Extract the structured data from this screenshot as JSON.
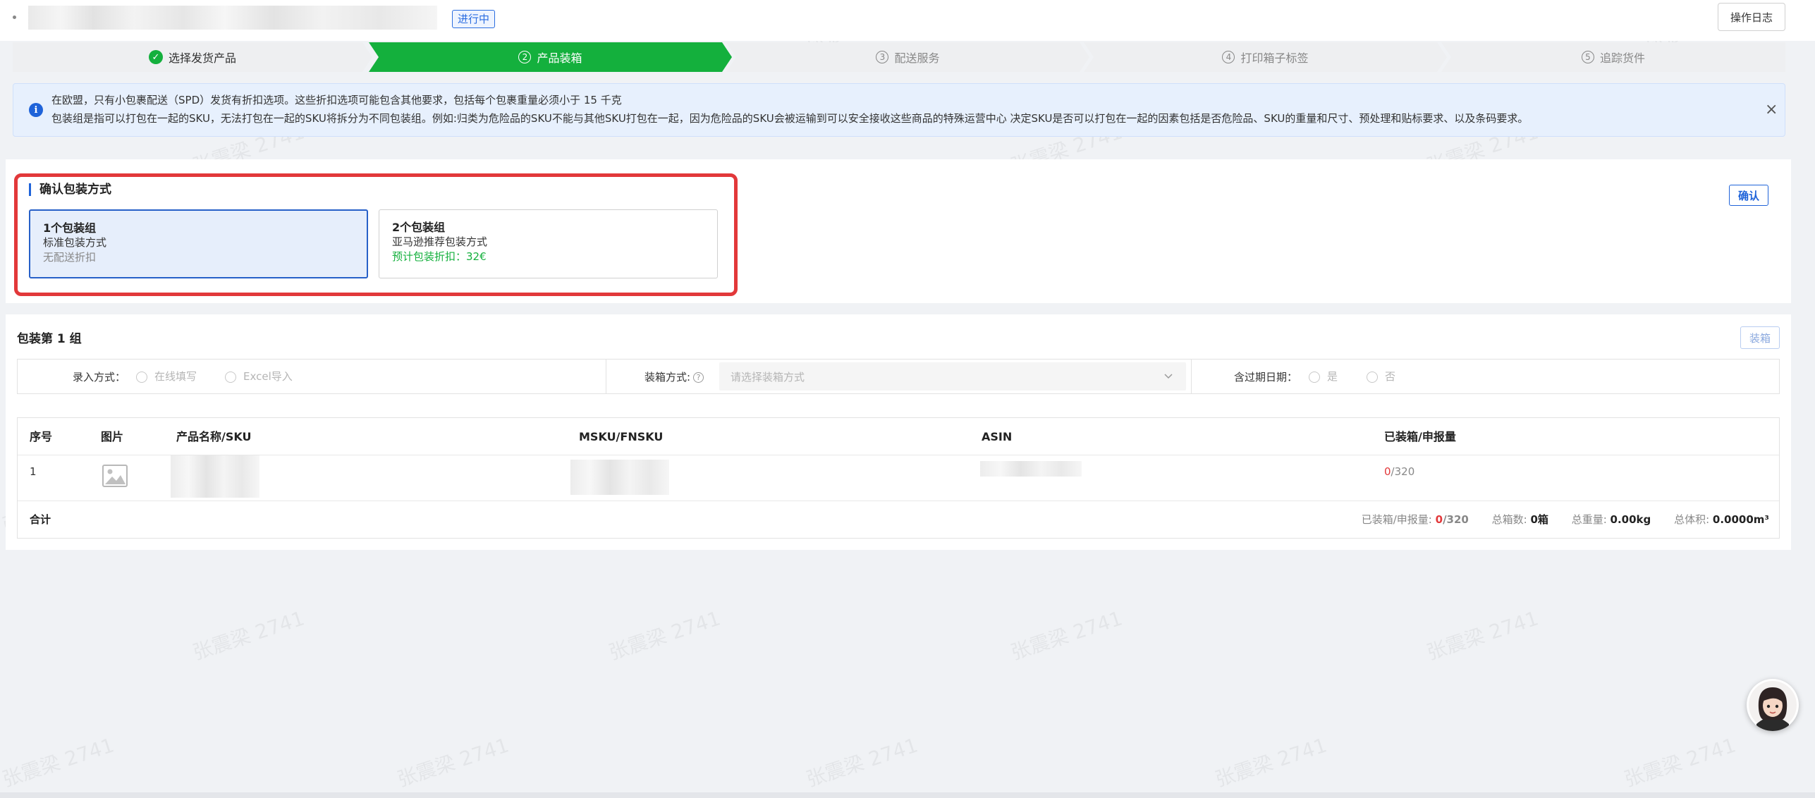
{
  "header": {
    "status": "进行中",
    "log_button": "操作日志"
  },
  "steps": [
    {
      "num": "✓",
      "label": "选择发货产品",
      "state": "done"
    },
    {
      "num": "2",
      "label": "产品装箱",
      "state": "active"
    },
    {
      "num": "3",
      "label": "配送服务",
      "state": "todo"
    },
    {
      "num": "4",
      "label": "打印箱子标签",
      "state": "todo"
    },
    {
      "num": "5",
      "label": "追踪货件",
      "state": "todo"
    }
  ],
  "notice": {
    "line1": "在欧盟，只有小包裹配送（SPD）发货有折扣选项。这些折扣选项可能包含其他要求，包括每个包裹重量必须小于 15 千克",
    "line2": "包装组是指可以打包在一起的SKU，无法打包在一起的SKU将拆分为不同包装组。例如:归类为危险品的SKU不能与其他SKU打包在一起，因为危险品的SKU会被运输到可以安全接收这些商品的特殊运营中心 决定SKU是否可以打包在一起的因素包括是否危险品、SKU的重量和尺寸、预处理和贴标要求、以及条码要求。",
    "close": "×"
  },
  "packing_method": {
    "title": "确认包装方式",
    "confirm_button": "确认",
    "options": [
      {
        "title": "1个包装组",
        "subtitle": "标准包装方式",
        "note": "无配送折扣"
      },
      {
        "title": "2个包装组",
        "subtitle": "亚马逊推荐包装方式",
        "note": "预计包装折扣：32€"
      }
    ]
  },
  "group": {
    "title": "包装第 1 组",
    "pack_button": "装箱",
    "entry_label": "录入方式：",
    "entry_options": [
      "在线填写",
      "Excel导入"
    ],
    "box_label": "装箱方式:",
    "box_placeholder": "请选择装箱方式",
    "expiry_label": "含过期日期：",
    "expiry_options": [
      "是",
      "否"
    ]
  },
  "table": {
    "headers": [
      "序号",
      "图片",
      "产品名称/SKU",
      "MSKU/FNSKU",
      "ASIN",
      "已装箱/申报量"
    ],
    "rows": [
      {
        "index": "1",
        "packed": "0",
        "declared": "/320"
      }
    ],
    "summary": {
      "label": "合计",
      "packed_label": "已装箱/申报量:",
      "packed": "0",
      "declared": "/320",
      "boxes_label": "总箱数:",
      "boxes": "0箱",
      "weight_label": "总重量:",
      "weight": "0.00kg",
      "volume_label": "总体积:",
      "volume": "0.0000m³"
    }
  },
  "watermark": "张震梁 2741"
}
